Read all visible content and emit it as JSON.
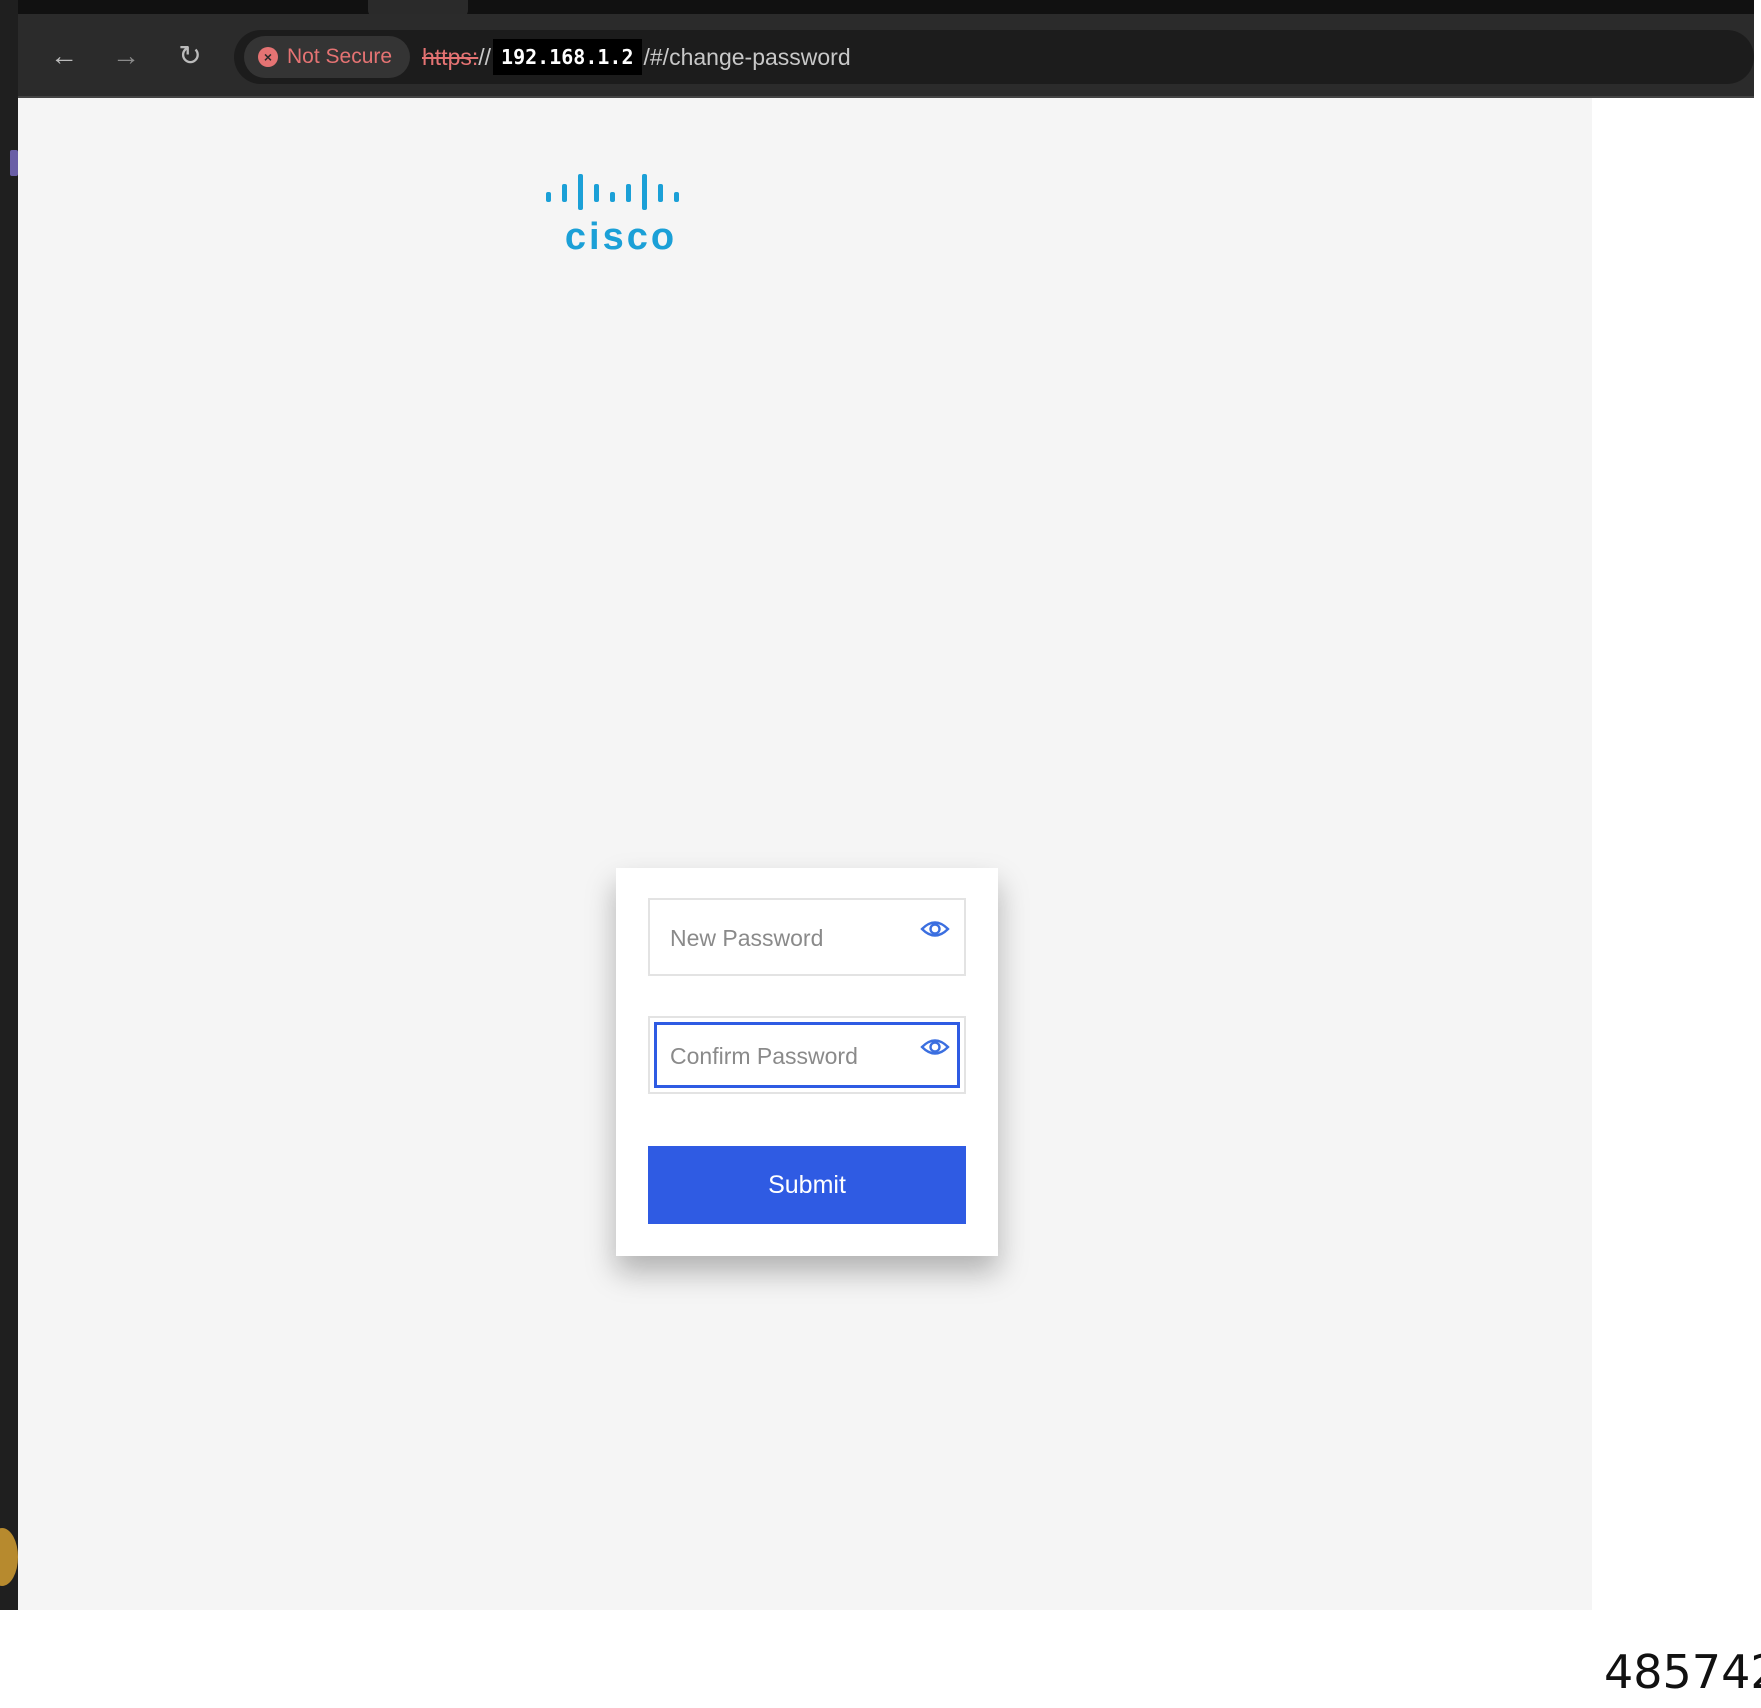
{
  "browser": {
    "security_label": "Not Secure",
    "url_scheme": "https:",
    "url_slashes": "//",
    "url_host": "192.168.1.2",
    "url_path": "/#/change-password"
  },
  "page": {
    "logo_text": "cisco",
    "logo_color": "#1ba0d7",
    "new_password_placeholder": "New Password",
    "confirm_password_placeholder": "Confirm Password",
    "submit_label": "Submit",
    "accent_color": "#2f5be3"
  },
  "figure_number": "485742"
}
